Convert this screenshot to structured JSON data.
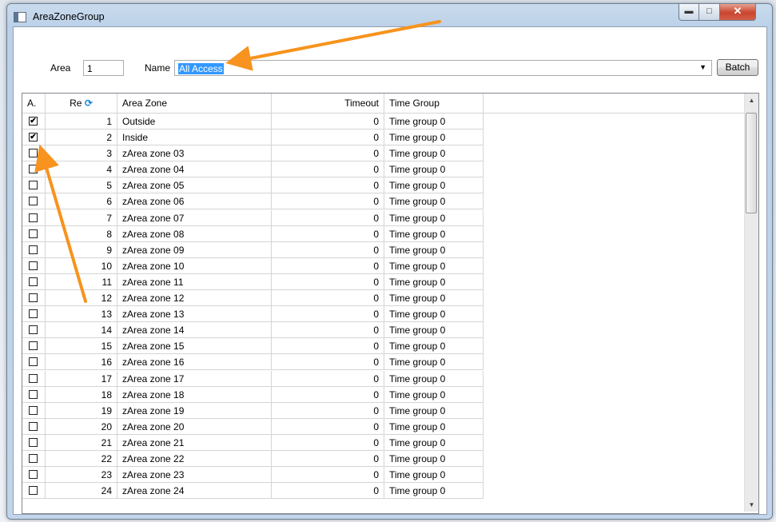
{
  "window": {
    "title": "AreaZoneGroup"
  },
  "form": {
    "area_label": "Area",
    "area_value": "1",
    "name_label": "Name",
    "name_value": "All Access",
    "batch_label": "Batch"
  },
  "grid": {
    "headers": {
      "active": "A.",
      "rec": "Re",
      "area_zone": "Area Zone",
      "timeout": "Timeout",
      "time_group": "Time Group"
    },
    "rows": [
      {
        "checked": true,
        "rec": "1",
        "zone": "Outside",
        "timeout": "0",
        "group": "Time group 0"
      },
      {
        "checked": true,
        "rec": "2",
        "zone": "Inside",
        "timeout": "0",
        "group": "Time group 0"
      },
      {
        "checked": false,
        "rec": "3",
        "zone": "zArea zone 03",
        "timeout": "0",
        "group": "Time group 0"
      },
      {
        "checked": false,
        "rec": "4",
        "zone": "zArea zone 04",
        "timeout": "0",
        "group": "Time group 0"
      },
      {
        "checked": false,
        "rec": "5",
        "zone": "zArea zone 05",
        "timeout": "0",
        "group": "Time group 0"
      },
      {
        "checked": false,
        "rec": "6",
        "zone": "zArea zone 06",
        "timeout": "0",
        "group": "Time group 0"
      },
      {
        "checked": false,
        "rec": "7",
        "zone": "zArea zone 07",
        "timeout": "0",
        "group": "Time group 0"
      },
      {
        "checked": false,
        "rec": "8",
        "zone": "zArea zone 08",
        "timeout": "0",
        "group": "Time group 0"
      },
      {
        "checked": false,
        "rec": "9",
        "zone": "zArea zone 09",
        "timeout": "0",
        "group": "Time group 0"
      },
      {
        "checked": false,
        "rec": "10",
        "zone": "zArea zone 10",
        "timeout": "0",
        "group": "Time group 0"
      },
      {
        "checked": false,
        "rec": "11",
        "zone": "zArea zone 11",
        "timeout": "0",
        "group": "Time group 0"
      },
      {
        "checked": false,
        "rec": "12",
        "zone": "zArea zone 12",
        "timeout": "0",
        "group": "Time group 0"
      },
      {
        "checked": false,
        "rec": "13",
        "zone": "zArea zone 13",
        "timeout": "0",
        "group": "Time group 0"
      },
      {
        "checked": false,
        "rec": "14",
        "zone": "zArea zone 14",
        "timeout": "0",
        "group": "Time group 0"
      },
      {
        "checked": false,
        "rec": "15",
        "zone": "zArea zone 15",
        "timeout": "0",
        "group": "Time group 0"
      },
      {
        "checked": false,
        "rec": "16",
        "zone": "zArea zone 16",
        "timeout": "0",
        "group": "Time group 0"
      },
      {
        "checked": false,
        "rec": "17",
        "zone": "zArea zone 17",
        "timeout": "0",
        "group": "Time group 0"
      },
      {
        "checked": false,
        "rec": "18",
        "zone": "zArea zone 18",
        "timeout": "0",
        "group": "Time group 0"
      },
      {
        "checked": false,
        "rec": "19",
        "zone": "zArea zone 19",
        "timeout": "0",
        "group": "Time group 0"
      },
      {
        "checked": false,
        "rec": "20",
        "zone": "zArea zone 20",
        "timeout": "0",
        "group": "Time group 0"
      },
      {
        "checked": false,
        "rec": "21",
        "zone": "zArea zone 21",
        "timeout": "0",
        "group": "Time group 0"
      },
      {
        "checked": false,
        "rec": "22",
        "zone": "zArea zone 22",
        "timeout": "0",
        "group": "Time group 0"
      },
      {
        "checked": false,
        "rec": "23",
        "zone": "zArea zone 23",
        "timeout": "0",
        "group": "Time group 0"
      },
      {
        "checked": false,
        "rec": "24",
        "zone": "zArea zone 24",
        "timeout": "0",
        "group": "Time group 0"
      }
    ]
  },
  "annotations": {
    "arrow_color": "#f7931e"
  },
  "icons": {
    "sort": "sort-refresh-icon",
    "checkbox": "checkbox-icon"
  }
}
